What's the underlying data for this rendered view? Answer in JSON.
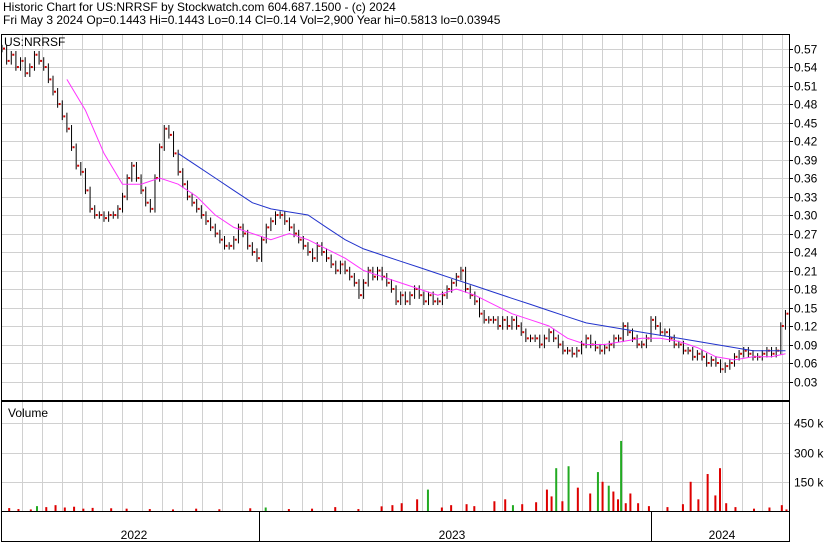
{
  "header": {
    "line1": "Historic Chart for US:NRRSF by Stockwatch.com 604.687.1500 - (c) 2024",
    "line2": "Fri May  3 2024  Op=0.1443  Hi=0.1443  Lo=0.14  Cl=0.14  Vol=2,900  Year hi=0.5813  lo=0.03945"
  },
  "chart_data": [
    {
      "type": "line",
      "title": "US:NRRSF",
      "y_tick_labels": [
        "0.57",
        "0.54",
        "0.51",
        "0.48",
        "0.45",
        "0.42",
        "0.39",
        "0.36",
        "0.33",
        "0.30",
        "0.27",
        "0.24",
        "0.21",
        "0.18",
        "0.15",
        "0.12",
        "0.09",
        "0.06",
        "0.03"
      ],
      "y_ticks": [
        0.57,
        0.54,
        0.51,
        0.48,
        0.45,
        0.42,
        0.39,
        0.36,
        0.33,
        0.3,
        0.27,
        0.24,
        0.21,
        0.18,
        0.15,
        0.12,
        0.09,
        0.06,
        0.03
      ],
      "ylim": [
        0.0,
        0.592
      ],
      "x_tick_labels": [
        "2022",
        "2023",
        "2024"
      ],
      "grid": true,
      "colors": {
        "price": "#000000",
        "close_dot": "#cc0000",
        "ma_short": "#ff33ff",
        "ma_long": "#2233cc"
      },
      "price_points": [
        [
          0,
          0.57
        ],
        [
          3,
          0.55
        ],
        [
          6,
          0.56
        ],
        [
          9,
          0.54
        ],
        [
          12,
          0.55
        ],
        [
          15,
          0.53
        ],
        [
          18,
          0.54
        ],
        [
          21,
          0.56
        ],
        [
          24,
          0.55
        ],
        [
          27,
          0.54
        ],
        [
          30,
          0.52
        ],
        [
          33,
          0.5
        ],
        [
          36,
          0.48
        ],
        [
          39,
          0.46
        ],
        [
          42,
          0.44
        ],
        [
          45,
          0.41
        ],
        [
          48,
          0.38
        ],
        [
          51,
          0.37
        ],
        [
          54,
          0.34
        ],
        [
          57,
          0.31
        ],
        [
          60,
          0.3
        ],
        [
          63,
          0.3
        ],
        [
          66,
          0.295
        ],
        [
          69,
          0.3
        ],
        [
          72,
          0.3
        ],
        [
          75,
          0.31
        ],
        [
          78,
          0.33
        ],
        [
          81,
          0.36
        ],
        [
          84,
          0.38
        ],
        [
          87,
          0.36
        ],
        [
          90,
          0.34
        ],
        [
          93,
          0.32
        ],
        [
          96,
          0.31
        ],
        [
          99,
          0.36
        ],
        [
          102,
          0.41
        ],
        [
          105,
          0.44
        ],
        [
          108,
          0.43
        ],
        [
          111,
          0.4
        ],
        [
          114,
          0.37
        ],
        [
          117,
          0.35
        ],
        [
          120,
          0.33
        ],
        [
          123,
          0.32
        ],
        [
          126,
          0.31
        ],
        [
          129,
          0.3
        ],
        [
          132,
          0.29
        ],
        [
          135,
          0.28
        ],
        [
          138,
          0.27
        ],
        [
          141,
          0.26
        ],
        [
          144,
          0.25
        ],
        [
          147,
          0.25
        ],
        [
          150,
          0.26
        ],
        [
          153,
          0.28
        ],
        [
          156,
          0.27
        ],
        [
          159,
          0.25
        ],
        [
          162,
          0.24
        ],
        [
          165,
          0.23
        ],
        [
          168,
          0.26
        ],
        [
          171,
          0.28
        ],
        [
          174,
          0.29
        ],
        [
          177,
          0.3
        ],
        [
          180,
          0.3
        ],
        [
          183,
          0.29
        ],
        [
          186,
          0.28
        ],
        [
          189,
          0.27
        ],
        [
          192,
          0.26
        ],
        [
          195,
          0.25
        ],
        [
          198,
          0.24
        ],
        [
          201,
          0.23
        ],
        [
          204,
          0.25
        ],
        [
          207,
          0.24
        ],
        [
          210,
          0.23
        ],
        [
          213,
          0.22
        ],
        [
          216,
          0.21
        ],
        [
          219,
          0.22
        ],
        [
          222,
          0.21
        ],
        [
          225,
          0.2
        ],
        [
          228,
          0.19
        ],
        [
          231,
          0.17
        ],
        [
          234,
          0.19
        ],
        [
          237,
          0.21
        ],
        [
          240,
          0.2
        ],
        [
          243,
          0.21
        ],
        [
          246,
          0.2
        ],
        [
          249,
          0.19
        ],
        [
          252,
          0.18
        ],
        [
          255,
          0.16
        ],
        [
          258,
          0.17
        ],
        [
          261,
          0.16
        ],
        [
          264,
          0.17
        ],
        [
          267,
          0.18
        ],
        [
          270,
          0.17
        ],
        [
          273,
          0.16
        ],
        [
          276,
          0.17
        ],
        [
          279,
          0.16
        ],
        [
          282,
          0.16
        ],
        [
          285,
          0.17
        ],
        [
          288,
          0.18
        ],
        [
          291,
          0.19
        ],
        [
          294,
          0.2
        ],
        [
          297,
          0.21
        ],
        [
          300,
          0.18
        ],
        [
          303,
          0.17
        ],
        [
          306,
          0.16
        ],
        [
          309,
          0.14
        ],
        [
          312,
          0.13
        ],
        [
          315,
          0.13
        ],
        [
          318,
          0.13
        ],
        [
          321,
          0.12
        ],
        [
          324,
          0.13
        ],
        [
          327,
          0.12
        ],
        [
          330,
          0.13
        ],
        [
          333,
          0.12
        ],
        [
          336,
          0.11
        ],
        [
          339,
          0.1
        ],
        [
          342,
          0.1
        ],
        [
          345,
          0.1
        ],
        [
          348,
          0.09
        ],
        [
          351,
          0.1
        ],
        [
          354,
          0.11
        ],
        [
          357,
          0.1
        ],
        [
          360,
          0.09
        ],
        [
          363,
          0.08
        ],
        [
          366,
          0.08
        ],
        [
          369,
          0.075
        ],
        [
          372,
          0.08
        ],
        [
          375,
          0.09
        ],
        [
          378,
          0.1
        ],
        [
          381,
          0.09
        ],
        [
          384,
          0.085
        ],
        [
          387,
          0.08
        ],
        [
          390,
          0.085
        ],
        [
          393,
          0.09
        ],
        [
          396,
          0.1
        ],
        [
          399,
          0.1
        ],
        [
          402,
          0.12
        ],
        [
          405,
          0.11
        ],
        [
          408,
          0.1
        ],
        [
          411,
          0.09
        ],
        [
          414,
          0.09
        ],
        [
          417,
          0.1
        ],
        [
          420,
          0.13
        ],
        [
          423,
          0.12
        ],
        [
          426,
          0.11
        ],
        [
          429,
          0.11
        ],
        [
          432,
          0.1
        ],
        [
          435,
          0.09
        ],
        [
          438,
          0.09
        ],
        [
          441,
          0.08
        ],
        [
          444,
          0.08
        ],
        [
          447,
          0.07
        ],
        [
          450,
          0.075
        ],
        [
          453,
          0.07
        ],
        [
          456,
          0.06
        ],
        [
          459,
          0.065
        ],
        [
          462,
          0.06
        ],
        [
          465,
          0.05
        ],
        [
          468,
          0.055
        ],
        [
          471,
          0.06
        ],
        [
          474,
          0.07
        ],
        [
          477,
          0.075
        ],
        [
          480,
          0.08
        ],
        [
          483,
          0.075
        ],
        [
          486,
          0.07
        ],
        [
          489,
          0.07
        ],
        [
          492,
          0.075
        ],
        [
          495,
          0.08
        ],
        [
          498,
          0.075
        ],
        [
          501,
          0.08
        ],
        [
          504,
          0.12
        ],
        [
          507,
          0.14
        ]
      ],
      "ma_short_points": [
        [
          42,
          0.52
        ],
        [
          54,
          0.47
        ],
        [
          66,
          0.4
        ],
        [
          78,
          0.35
        ],
        [
          90,
          0.35
        ],
        [
          102,
          0.36
        ],
        [
          114,
          0.35
        ],
        [
          126,
          0.33
        ],
        [
          138,
          0.3
        ],
        [
          150,
          0.28
        ],
        [
          162,
          0.27
        ],
        [
          174,
          0.26
        ],
        [
          186,
          0.27
        ],
        [
          198,
          0.26
        ],
        [
          210,
          0.245
        ],
        [
          222,
          0.23
        ],
        [
          234,
          0.21
        ],
        [
          246,
          0.2
        ],
        [
          258,
          0.19
        ],
        [
          270,
          0.18
        ],
        [
          282,
          0.17
        ],
        [
          294,
          0.18
        ],
        [
          306,
          0.17
        ],
        [
          318,
          0.155
        ],
        [
          330,
          0.14
        ],
        [
          342,
          0.13
        ],
        [
          354,
          0.12
        ],
        [
          366,
          0.1
        ],
        [
          378,
          0.09
        ],
        [
          390,
          0.09
        ],
        [
          402,
          0.095
        ],
        [
          414,
          0.1
        ],
        [
          426,
          0.1
        ],
        [
          438,
          0.095
        ],
        [
          450,
          0.085
        ],
        [
          462,
          0.07
        ],
        [
          474,
          0.065
        ],
        [
          486,
          0.07
        ],
        [
          498,
          0.07
        ],
        [
          507,
          0.075
        ]
      ],
      "ma_long_points": [
        [
          114,
          0.4
        ],
        [
          126,
          0.38
        ],
        [
          138,
          0.36
        ],
        [
          150,
          0.34
        ],
        [
          162,
          0.32
        ],
        [
          174,
          0.31
        ],
        [
          186,
          0.305
        ],
        [
          198,
          0.3
        ],
        [
          210,
          0.28
        ],
        [
          222,
          0.26
        ],
        [
          234,
          0.245
        ],
        [
          246,
          0.235
        ],
        [
          258,
          0.225
        ],
        [
          270,
          0.215
        ],
        [
          282,
          0.205
        ],
        [
          294,
          0.195
        ],
        [
          306,
          0.185
        ],
        [
          318,
          0.175
        ],
        [
          330,
          0.165
        ],
        [
          342,
          0.155
        ],
        [
          354,
          0.145
        ],
        [
          366,
          0.135
        ],
        [
          378,
          0.125
        ],
        [
          390,
          0.12
        ],
        [
          402,
          0.115
        ],
        [
          414,
          0.11
        ],
        [
          426,
          0.105
        ],
        [
          438,
          0.1
        ],
        [
          450,
          0.095
        ],
        [
          462,
          0.09
        ],
        [
          474,
          0.085
        ],
        [
          486,
          0.08
        ],
        [
          498,
          0.08
        ],
        [
          507,
          0.08
        ]
      ]
    },
    {
      "type": "bar",
      "title": "Volume",
      "y_tick_labels": [
        "450 k",
        "300 k",
        "150 k"
      ],
      "y_ticks": [
        450,
        300,
        150
      ],
      "ylim": [
        0,
        560
      ],
      "units": "k",
      "colors": {
        "up": "#22aa22",
        "down": "#dd0000"
      },
      "volumes": [
        [
          4,
          15,
          "d"
        ],
        [
          10,
          10,
          "d"
        ],
        [
          18,
          8,
          "d"
        ],
        [
          22,
          25,
          "u"
        ],
        [
          28,
          20,
          "d"
        ],
        [
          34,
          30,
          "d"
        ],
        [
          40,
          18,
          "d"
        ],
        [
          46,
          22,
          "d"
        ],
        [
          52,
          12,
          "d"
        ],
        [
          58,
          16,
          "d"
        ],
        [
          70,
          14,
          "d"
        ],
        [
          80,
          12,
          "d"
        ],
        [
          95,
          10,
          "d"
        ],
        [
          110,
          8,
          "d"
        ],
        [
          125,
          12,
          "d"
        ],
        [
          140,
          9,
          "d"
        ],
        [
          160,
          14,
          "d"
        ],
        [
          170,
          18,
          "u"
        ],
        [
          185,
          10,
          "d"
        ],
        [
          200,
          12,
          "d"
        ],
        [
          215,
          20,
          "d"
        ],
        [
          230,
          10,
          "d"
        ],
        [
          245,
          24,
          "d"
        ],
        [
          252,
          30,
          "d"
        ],
        [
          258,
          40,
          "d"
        ],
        [
          268,
          60,
          "d"
        ],
        [
          275,
          110,
          "u"
        ],
        [
          284,
          18,
          "d"
        ],
        [
          290,
          30,
          "d"
        ],
        [
          300,
          35,
          "d"
        ],
        [
          305,
          25,
          "d"
        ],
        [
          318,
          50,
          "d"
        ],
        [
          325,
          60,
          "d"
        ],
        [
          330,
          30,
          "u"
        ],
        [
          336,
          35,
          "d"
        ],
        [
          345,
          45,
          "d"
        ],
        [
          352,
          110,
          "d"
        ],
        [
          355,
          75,
          "d"
        ],
        [
          358,
          220,
          "u"
        ],
        [
          362,
          50,
          "d"
        ],
        [
          366,
          230,
          "u"
        ],
        [
          372,
          120,
          "d"
        ],
        [
          380,
          90,
          "d"
        ],
        [
          385,
          200,
          "u"
        ],
        [
          388,
          150,
          "d"
        ],
        [
          392,
          130,
          "u"
        ],
        [
          395,
          100,
          "d"
        ],
        [
          398,
          60,
          "d"
        ],
        [
          400,
          360,
          "u"
        ],
        [
          403,
          40,
          "d"
        ],
        [
          406,
          90,
          "d"
        ],
        [
          411,
          40,
          "d"
        ],
        [
          418,
          25,
          "d"
        ],
        [
          430,
          20,
          "d"
        ],
        [
          440,
          35,
          "d"
        ],
        [
          445,
          150,
          "d"
        ],
        [
          450,
          60,
          "d"
        ],
        [
          456,
          190,
          "d"
        ],
        [
          461,
          80,
          "d"
        ],
        [
          464,
          220,
          "d"
        ],
        [
          468,
          40,
          "d"
        ],
        [
          474,
          20,
          "d"
        ],
        [
          486,
          12,
          "d"
        ],
        [
          496,
          18,
          "d"
        ],
        [
          504,
          30,
          "d"
        ],
        [
          507,
          8,
          "d"
        ]
      ]
    }
  ]
}
